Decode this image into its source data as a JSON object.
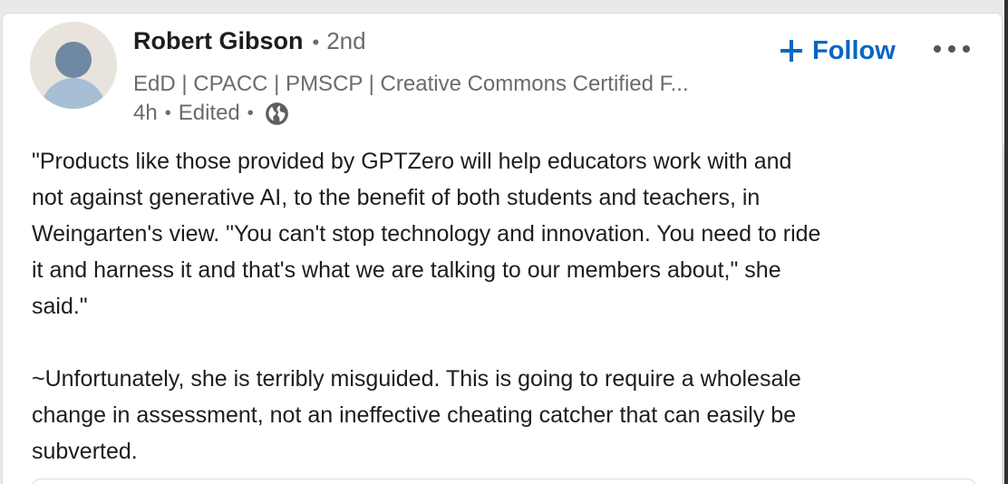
{
  "post": {
    "author": {
      "name": "Robert Gibson",
      "separator": "•",
      "degree": "2nd",
      "headline": "EdD | CPACC | PMSCP | Creative Commons Certified F...",
      "avatar_icon": "default-avatar-icon"
    },
    "meta": {
      "time": "4h",
      "separator": "•",
      "edited": "Edited",
      "separator2": "•",
      "visibility_icon": "globe-icon"
    },
    "actions": {
      "follow_icon": "plus-icon",
      "follow_label": "Follow",
      "more_icon": "more-horizontal-icon"
    },
    "body": {
      "paragraph_1": "\"Products like those provided by GPTZero will help educators work with and\nnot against generative AI, to the benefit of both students and teachers, in\nWeingarten's view. \"You can't stop technology and innovation. You need to ride\nit and harness it and that's what we are talking to our members about,\" she\nsaid.\"",
      "paragraph_2": "~Unfortunately, she is terribly misguided. This is going to require a wholesale\nchange in assessment, not an ineffective cheating catcher that can easily be\nsubverted."
    }
  },
  "colors": {
    "accent": "#0a66c2",
    "text_primary": "#1d1d1d",
    "text_secondary": "#6b6b6b",
    "card_background": "#ffffff",
    "page_background": "#e9e9e9"
  }
}
